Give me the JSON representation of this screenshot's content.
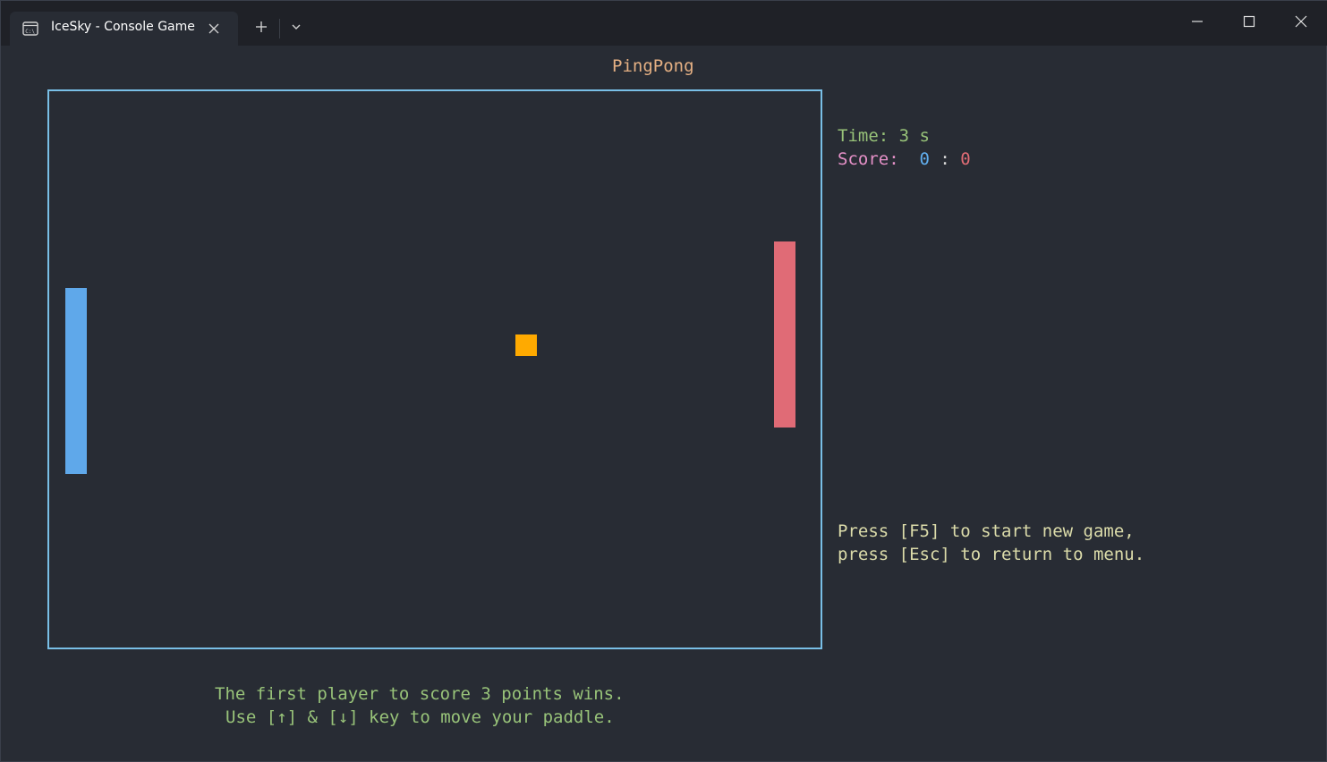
{
  "window": {
    "tab_title": "IceSky - Console Game",
    "icons": {
      "tab": "console-icon",
      "close_tab": "close-icon",
      "new_tab": "plus-icon",
      "dropdown": "chevron-down-icon",
      "minimize": "minimize-icon",
      "maximize": "maximize-icon",
      "close_window": "close-icon"
    }
  },
  "game": {
    "title": "PingPong",
    "time_line": "Time: 3 s",
    "score_label": "Score:  ",
    "score_left": "0",
    "score_sep": " : ",
    "score_right": "0",
    "help_line_1": "Press [F5] to start new game,",
    "help_line_2": "press [Esc] to return to menu.",
    "rule_line_1": "The first player to score 3 points wins.",
    "rule_line_2": "Use [↑] & [↓] key to move your paddle."
  },
  "colors": {
    "background": "#282c34",
    "arena_border": "#79bfe6",
    "left_paddle": "#5fa8ea",
    "right_paddle": "#e06b76",
    "ball": "#ffaa00",
    "title": "#e5b083",
    "time": "#98c379",
    "score_label": "#e691c8",
    "help": "#dcdcaa",
    "rules": "#98c379"
  }
}
